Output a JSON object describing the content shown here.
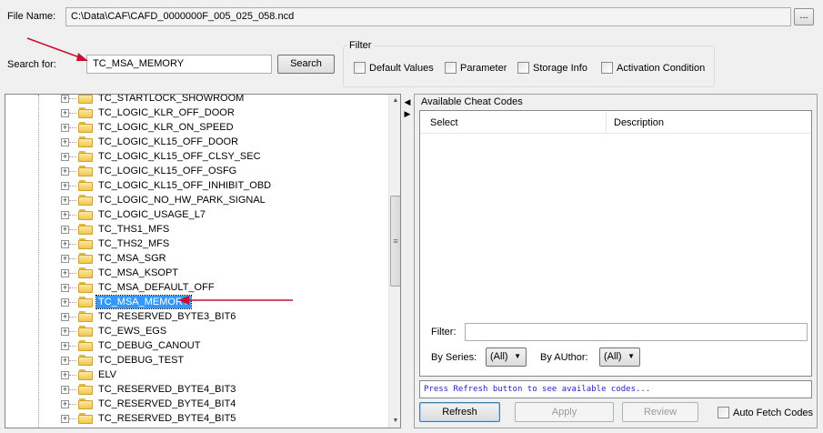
{
  "file": {
    "label": "File Name:",
    "value": "C:\\Data\\CAF\\CAFD_0000000F_005_025_058.ncd",
    "browse_label": "..."
  },
  "search": {
    "label": "Search for:",
    "value": "TC_MSA_MEMORY",
    "button_label": "Search"
  },
  "filter": {
    "legend": "Filter",
    "options": [
      {
        "label": "Default Values",
        "checked": false
      },
      {
        "label": "Parameter",
        "checked": false
      },
      {
        "label": "Storage Info",
        "checked": false
      },
      {
        "label": "Activation Condition",
        "checked": false
      }
    ]
  },
  "tree": {
    "items": [
      {
        "label": "TC_STARTLOCK_SHOWROOM"
      },
      {
        "label": "TC_LOGIC_KLR_OFF_DOOR"
      },
      {
        "label": "TC_LOGIC_KLR_ON_SPEED"
      },
      {
        "label": "TC_LOGIC_KL15_OFF_DOOR"
      },
      {
        "label": "TC_LOGIC_KL15_OFF_CLSY_SEC"
      },
      {
        "label": "TC_LOGIC_KL15_OFF_OSFG"
      },
      {
        "label": "TC_LOGIC_KL15_OFF_INHIBIT_OBD"
      },
      {
        "label": "TC_LOGIC_NO_HW_PARK_SIGNAL"
      },
      {
        "label": "TC_LOGIC_USAGE_L7"
      },
      {
        "label": "TC_THS1_MFS"
      },
      {
        "label": "TC_THS2_MFS"
      },
      {
        "label": "TC_MSA_SGR"
      },
      {
        "label": "TC_MSA_KSOPT"
      },
      {
        "label": "TC_MSA_DEFAULT_OFF"
      },
      {
        "label": "TC_MSA_MEMORY",
        "selected": true
      },
      {
        "label": "TC_RESERVED_BYTE3_BIT6"
      },
      {
        "label": "TC_EWS_EGS"
      },
      {
        "label": "TC_DEBUG_CANOUT"
      },
      {
        "label": "TC_DEBUG_TEST"
      },
      {
        "label": "ELV"
      },
      {
        "label": "TC_RESERVED_BYTE4_BIT3"
      },
      {
        "label": "TC_RESERVED_BYTE4_BIT4"
      },
      {
        "label": "TC_RESERVED_BYTE4_BIT5"
      }
    ]
  },
  "cheat_codes": {
    "title": "Available Cheat Codes",
    "columns": [
      "Select",
      "Description"
    ],
    "filter_label": "Filter:",
    "filter_value": "",
    "by_series_label": "By Series:",
    "by_series_value": "(All)",
    "by_author_label": "By AUthor:",
    "by_author_value": "(All)",
    "status": "Press Refresh button to see available codes...",
    "refresh_label": "Refresh",
    "apply_label": "Apply",
    "review_label": "Review",
    "auto_fetch_label": "Auto Fetch Codes",
    "auto_fetch_checked": false
  },
  "colors": {
    "selection": "#3399ff",
    "annotation_arrow": "#c8102e",
    "status_text": "#2222cc"
  }
}
